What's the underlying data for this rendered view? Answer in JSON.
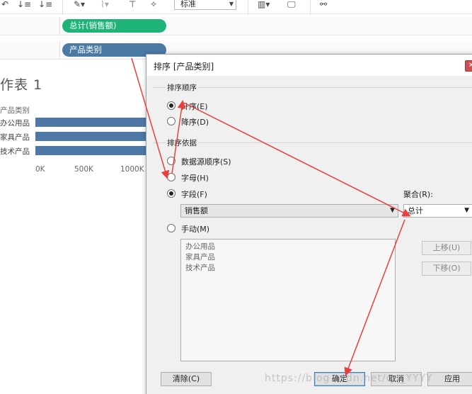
{
  "toolbar": {
    "icons": [
      "sort-ascending-icon",
      "sort-descending-icon",
      "highlighter-icon",
      "paperclip-icon",
      "label-icon",
      "pin-icon",
      "show-me-icon",
      "presentation-icon",
      "share-icon"
    ],
    "fit_select": "标准"
  },
  "shelves": {
    "columns_pill": "总计(销售额)",
    "rows_pill": "产品类别"
  },
  "worksheet": {
    "title": "作表 1",
    "row_header": "产品类别",
    "categories": [
      "办公用品",
      "家具产品",
      "技术产品"
    ],
    "axis_ticks": [
      "0K",
      "500K",
      "1000K"
    ]
  },
  "dialog": {
    "title": "排序 [产品类别]",
    "sort_order": {
      "heading": "排序顺序",
      "ascending": "升序(E)",
      "descending": "降序(D)"
    },
    "sort_by": {
      "heading": "排序依据",
      "data_source_order": "数据源顺序(S)",
      "alphabetic": "字母(H)",
      "field": "字段(F)",
      "field_value": "销售额",
      "aggregation_label": "聚合(R):",
      "aggregation_value": "总计",
      "manual": "手动(M)",
      "manual_items": [
        "办公用品",
        "家具产品",
        "技术产品"
      ],
      "move_up": "上移(U)",
      "move_down": "下移(O)"
    },
    "buttons": {
      "clear": "清除(C)",
      "ok": "确定",
      "cancel": "取消",
      "apply": "应用"
    }
  },
  "watermark": "https://blog.csdn.net/qq_YYYY",
  "colors": {
    "green_pill": "#1eb478",
    "blue_pill": "#4b7aa5",
    "bar": "#4e79a7",
    "arrow": "#e8403c"
  }
}
